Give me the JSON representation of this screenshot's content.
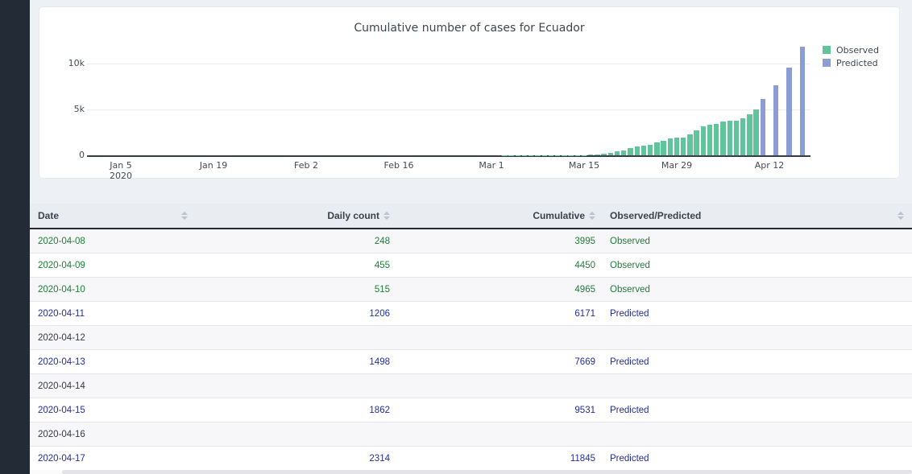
{
  "chart": {
    "title": "Cumulative number of cases for Ecuador",
    "y_ticks": [
      "10k",
      "5k",
      "0"
    ],
    "x_ticks": [
      "Jan 5",
      "Jan 19",
      "Feb 2",
      "Feb 16",
      "Mar 1",
      "Mar 15",
      "Mar 29",
      "Apr 12"
    ],
    "x_sub_label": "2020"
  },
  "chart_data": {
    "type": "bar",
    "title": "Cumulative number of cases for Ecuador",
    "xlabel": "",
    "ylabel": "",
    "ylim": [
      0,
      12500
    ],
    "y_tick_values": [
      0,
      5000,
      10000
    ],
    "x_tick_labels": [
      "Jan 5 2020",
      "Jan 19",
      "Feb 2",
      "Feb 16",
      "Mar 1",
      "Mar 15",
      "Mar 29",
      "Apr 12"
    ],
    "grid": true,
    "legend_position": "top-right",
    "series": [
      {
        "name": "Observed",
        "color": "#5fc69b",
        "points": [
          [
            "2020-03-01",
            6
          ],
          [
            "2020-03-02",
            6
          ],
          [
            "2020-03-03",
            7
          ],
          [
            "2020-03-04",
            10
          ],
          [
            "2020-03-05",
            13
          ],
          [
            "2020-03-06",
            13
          ],
          [
            "2020-03-07",
            14
          ],
          [
            "2020-03-08",
            14
          ],
          [
            "2020-03-09",
            15
          ],
          [
            "2020-03-10",
            15
          ],
          [
            "2020-03-11",
            17
          ],
          [
            "2020-03-12",
            17
          ],
          [
            "2020-03-13",
            23
          ],
          [
            "2020-03-14",
            28
          ],
          [
            "2020-03-15",
            37
          ],
          [
            "2020-03-16",
            58
          ],
          [
            "2020-03-17",
            111
          ],
          [
            "2020-03-18",
            168
          ],
          [
            "2020-03-19",
            260
          ],
          [
            "2020-03-20",
            426
          ],
          [
            "2020-03-21",
            506
          ],
          [
            "2020-03-22",
            789
          ],
          [
            "2020-03-23",
            981
          ],
          [
            "2020-03-24",
            1082
          ],
          [
            "2020-03-25",
            1173
          ],
          [
            "2020-03-26",
            1403
          ],
          [
            "2020-03-27",
            1595
          ],
          [
            "2020-03-28",
            1823
          ],
          [
            "2020-03-29",
            1924
          ],
          [
            "2020-03-30",
            1962
          ],
          [
            "2020-03-31",
            2240
          ],
          [
            "2020-04-01",
            2748
          ],
          [
            "2020-04-02",
            3163
          ],
          [
            "2020-04-03",
            3368
          ],
          [
            "2020-04-04",
            3465
          ],
          [
            "2020-04-05",
            3646
          ],
          [
            "2020-04-06",
            3747
          ],
          [
            "2020-04-07",
            3747
          ],
          [
            "2020-04-08",
            3995
          ],
          [
            "2020-04-09",
            4450
          ],
          [
            "2020-04-10",
            4965
          ]
        ]
      },
      {
        "name": "Predicted",
        "color": "#8c9dd3",
        "points": [
          [
            "2020-04-11",
            6171
          ],
          [
            "2020-04-13",
            7669
          ],
          [
            "2020-04-15",
            9531
          ],
          [
            "2020-04-17",
            11845
          ]
        ]
      }
    ]
  },
  "table": {
    "columns": [
      "Date",
      "Daily count",
      "Cumulative",
      "Observed/Predicted"
    ],
    "row_colors": {
      "Observed": "#1e7e38",
      "Predicted": "#232f9b",
      "default": "#363a40"
    },
    "rows": [
      {
        "date": "2020-04-08",
        "daily": "248",
        "cumulative": "3995",
        "type": "Observed"
      },
      {
        "date": "2020-04-09",
        "daily": "455",
        "cumulative": "4450",
        "type": "Observed"
      },
      {
        "date": "2020-04-10",
        "daily": "515",
        "cumulative": "4965",
        "type": "Observed"
      },
      {
        "date": "2020-04-11",
        "daily": "1206",
        "cumulative": "6171",
        "type": "Predicted"
      },
      {
        "date": "2020-04-12",
        "daily": "",
        "cumulative": "",
        "type": ""
      },
      {
        "date": "2020-04-13",
        "daily": "1498",
        "cumulative": "7669",
        "type": "Predicted"
      },
      {
        "date": "2020-04-14",
        "daily": "",
        "cumulative": "",
        "type": ""
      },
      {
        "date": "2020-04-15",
        "daily": "1862",
        "cumulative": "9531",
        "type": "Predicted"
      },
      {
        "date": "2020-04-16",
        "daily": "",
        "cumulative": "",
        "type": ""
      },
      {
        "date": "2020-04-17",
        "daily": "2314",
        "cumulative": "11845",
        "type": "Predicted"
      }
    ]
  }
}
